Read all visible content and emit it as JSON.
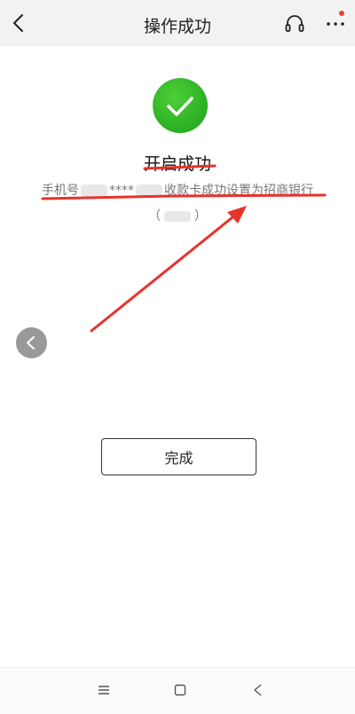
{
  "header": {
    "title": "操作成功",
    "back_icon": "chevron-left-icon",
    "support_icon": "headset-icon",
    "more_icon": "more-dots-icon",
    "notification_color": "#e2443c"
  },
  "result": {
    "success_icon": "checkmark-icon",
    "accent_color": "#2fb325",
    "title": "开启成功",
    "desc_prefix": "手机号",
    "desc_masked": "****",
    "desc_suffix": "收款卡成功设置为招商银行",
    "bank_open": "（",
    "bank_close": "）"
  },
  "actions": {
    "done_label": "完成"
  },
  "annotation": {
    "color": "#e8332c"
  },
  "system_nav": {
    "menu_icon": "menu-icon",
    "home_icon": "home-square-icon",
    "back_icon": "back-triangle-icon"
  }
}
